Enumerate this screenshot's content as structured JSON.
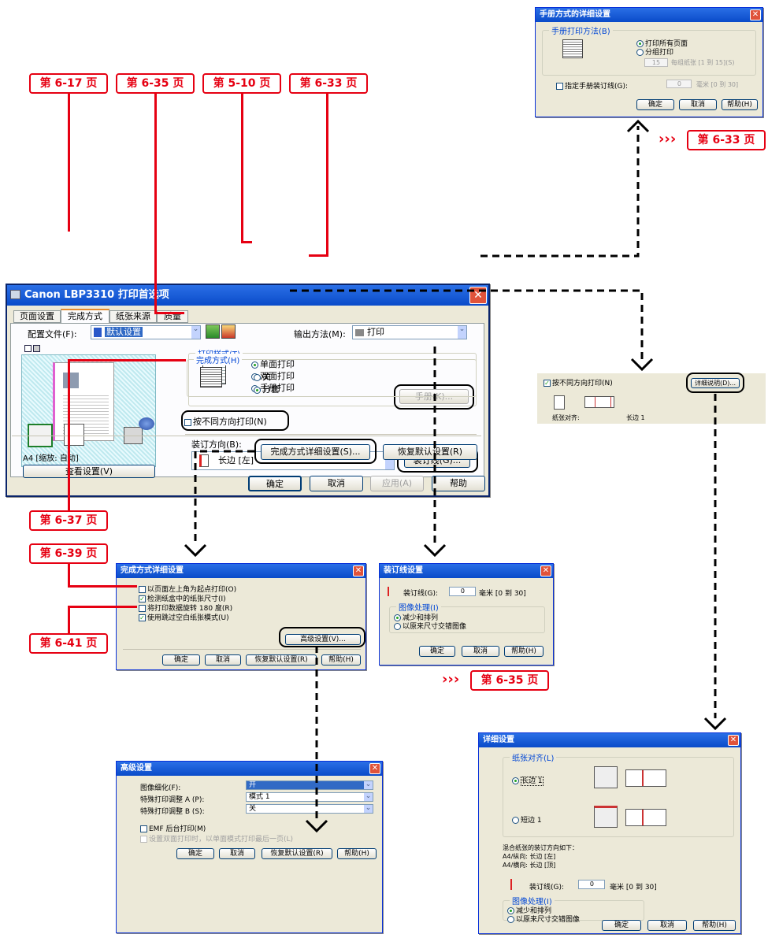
{
  "refs": {
    "r617": "第 6-17 页",
    "r635": "第 6-35 页",
    "r510": "第 5-10 页",
    "r633": "第 6-33 页",
    "r633b": "第 6-33 页",
    "r637": "第 6-37 页",
    "r639": "第 6-39 页",
    "r641": "第 6-41 页",
    "r635b": "第 6-35 页",
    "arrows": "›››"
  },
  "main": {
    "title": "Canon LBP3310 打印首选项",
    "tabs": [
      "页面设置",
      "完成方式",
      "纸张来源",
      "质量"
    ],
    "profile_label": "配置文件(F):",
    "profile_value": "默认设置",
    "output_label": "输出方法(M):",
    "output_value": "打印",
    "print_style_group": "打印样式(T)",
    "radio_single": "单面打印",
    "radio_duplex": "双面打印",
    "radio_booklet": "手册打印",
    "booklet_button": "手册(K)...",
    "rotate_check": "按不同方向打印(N)",
    "binding_label": "装订方向(B):",
    "binding_value": "长边 [左]",
    "gutter_button": "装订线(G)...",
    "finish_group": "完成方式(H)",
    "finish_off": "关",
    "finish_collate": "分套",
    "paper_status": "A4 [缩放: 自动]",
    "view_settings": "查看设置(V)",
    "finish_details": "完成方式详细设置(S)...",
    "restore": "恢复默认设置(R)",
    "ok": "确定",
    "cancel": "取消",
    "apply": "应用(A)",
    "help": "帮助"
  },
  "booklet": {
    "title": "手册方式的详细设置",
    "group": "手册打印方法(B)",
    "opt_all": "打印所有页面",
    "opt_split": "分组打印",
    "sheets_value": "15",
    "sheets_text": "每组纸张 [1 到 15](S)",
    "gutter_check": "指定手册装订线(G):",
    "gutter_value": "0",
    "gutter_text": "毫米 [0 到 30]",
    "ok": "确定",
    "cancel": "取消",
    "help": "帮助(H)"
  },
  "rotate_panel": {
    "check": "按不同方向打印(N)",
    "details": "详细说明(D)...",
    "align_label": "纸张对齐:",
    "align_value": "长边 1"
  },
  "finish_dlg": {
    "title": "完成方式详细设置",
    "items": [
      "以页面左上角为起点打印(O)",
      "检测纸盒中的纸张尺寸(I)",
      "将打印数据旋转 180 度(R)",
      "使用跳过空白纸张模式(U)"
    ],
    "checked": [
      false,
      true,
      false,
      true
    ],
    "advanced": "高级设置(V)...",
    "ok": "确定",
    "cancel": "取消",
    "restore": "恢复默认设置(R)",
    "help": "帮助(H)"
  },
  "gutter_dlg": {
    "title": "装订线设置",
    "gutter_label": "装订线(G):",
    "gutter_value": "0",
    "gutter_text": "毫米 [0 到 30]",
    "group": "图像处理(I)",
    "opt_reduce": "减少和排列",
    "opt_original": "以原来尺寸交错图像",
    "ok": "确定",
    "cancel": "取消",
    "help": "帮助(H)"
  },
  "adv_dlg": {
    "title": "高级设置",
    "rows": [
      {
        "label": "图像细化(F):",
        "value": "开"
      },
      {
        "label": "特殊打印调整 A (P):",
        "value": "模式 1"
      },
      {
        "label": "特殊打印调整 B (S):",
        "value": "关"
      }
    ],
    "emf": "EMF 后台打印(M)",
    "duplex_last": "设置双面打印时，以单面模式打印最后一页(L)",
    "ok": "确定",
    "cancel": "取消",
    "restore": "恢复默认设置(R)",
    "help": "帮助(H)"
  },
  "detail_dlg": {
    "title": "详细设置",
    "group": "纸张对齐(L)",
    "opt_long": "长边 1",
    "opt_short": "短边 1",
    "note1": "混合纸张的装订方向如下：",
    "note2": "A4/纵向: 长边 [左]",
    "note3": "A4/横向: 长边 [顶]",
    "gutter_label": "装订线(G):",
    "gutter_value": "0",
    "gutter_text": "毫米 [0 到 30]",
    "img_group": "图像处理(I)",
    "opt_reduce": "减少和排列",
    "opt_original": "以原来尺寸交错图像",
    "ok": "确定",
    "cancel": "取消",
    "help": "帮助(H)"
  }
}
